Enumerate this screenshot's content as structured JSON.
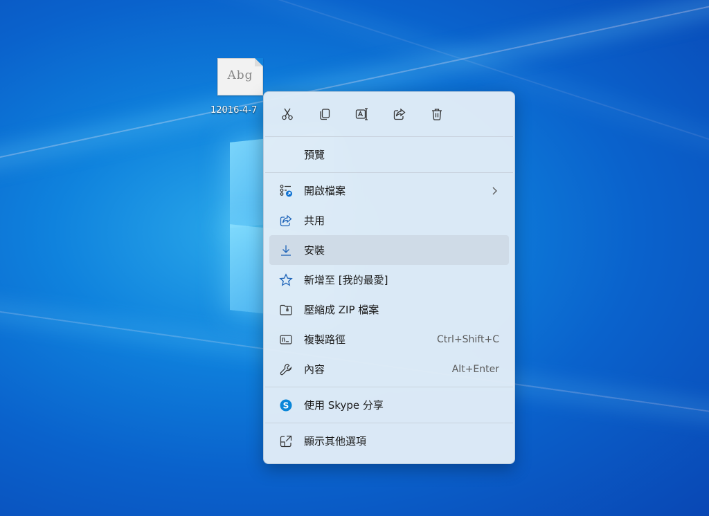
{
  "desktop": {
    "file": {
      "thumb_text": "Abg",
      "name": "12016-4-7"
    }
  },
  "context_menu": {
    "toolbar": [
      {
        "name": "cut",
        "icon": "scissors-icon"
      },
      {
        "name": "copy",
        "icon": "copy-icon"
      },
      {
        "name": "rename",
        "icon": "rename-icon"
      },
      {
        "name": "share",
        "icon": "share-icon"
      },
      {
        "name": "delete",
        "icon": "trash-icon"
      }
    ],
    "preview": "預覽",
    "items": [
      {
        "label": "開啟檔案",
        "icon": "open-with-icon",
        "submenu": true
      },
      {
        "label": "共用",
        "icon": "share-icon"
      },
      {
        "label": "安裝",
        "icon": "download-icon",
        "highlighted": true
      },
      {
        "label": "新增至 [我的最愛]",
        "icon": "star-icon"
      },
      {
        "label": "壓縮成 ZIP 檔案",
        "icon": "zip-folder-icon"
      },
      {
        "label": "複製路徑",
        "icon": "copy-path-icon",
        "shortcut": "Ctrl+Shift+C"
      },
      {
        "label": "內容",
        "icon": "wrench-icon",
        "shortcut": "Alt+Enter"
      }
    ],
    "skype": {
      "label": "使用 Skype 分享",
      "icon": "skype-icon",
      "accent": "#0078d4"
    },
    "more": {
      "label": "顯示其他選項",
      "icon": "open-external-icon"
    }
  }
}
